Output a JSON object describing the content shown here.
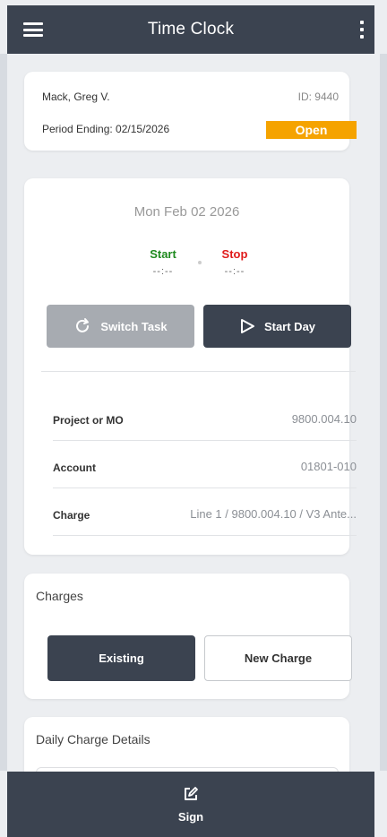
{
  "header": {
    "title": "Time Clock",
    "menu_icon": "hamburger-menu-icon",
    "more_icon": "more-vertical-icon"
  },
  "employee": {
    "name": "Mack, Greg V.",
    "id_label": "ID: 9440",
    "period_label": "Period Ending: 02/15/2026",
    "status": "Open",
    "status_color": "#f5a300"
  },
  "clock": {
    "date": "Mon Feb 02 2026",
    "start_label": "Start",
    "start_time": "--:--",
    "stop_label": "Stop",
    "stop_time": "--:--",
    "start_color": "#1f8a1f",
    "stop_color": "#e01b1b",
    "switch_task_label": "Switch Task",
    "switch_task_icon": "refresh-icon",
    "start_day_label": "Start Day",
    "start_day_icon": "play-outline-icon",
    "rows": [
      {
        "label": "Project or MO",
        "value": "9800.004.10"
      },
      {
        "label": "Account",
        "value": "01801-010"
      },
      {
        "label": "Charge",
        "value": "Line 1 / 9800.004.10 / V3 Ante..."
      }
    ]
  },
  "charges": {
    "title": "Charges",
    "existing_label": "Existing",
    "new_charge_label": "New Charge"
  },
  "daily": {
    "title": "Daily Charge Details"
  },
  "bottom": {
    "sign_label": "Sign",
    "sign_icon": "edit-square-icon"
  },
  "colors": {
    "primary": "#3b4350",
    "disabled": "#a7abb1",
    "background": "#eceef1"
  }
}
